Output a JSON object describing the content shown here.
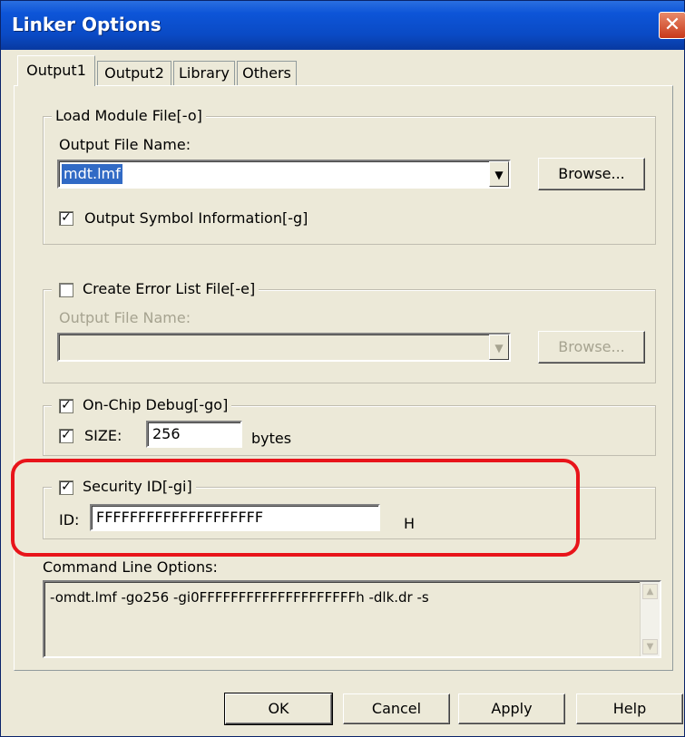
{
  "window": {
    "title": "Linker Options"
  },
  "tabs": [
    {
      "label": "Output1",
      "active": true
    },
    {
      "label": "Output2",
      "active": false
    },
    {
      "label": "Library",
      "active": false
    },
    {
      "label": "Others",
      "active": false
    }
  ],
  "load_module": {
    "group_title": "Load Module File[-o]",
    "output_label": "Output File Name:",
    "output_value": "mdt.lmf",
    "browse": "Browse...",
    "symbol_checked": true,
    "symbol_label": "Output Symbol Information[-g]"
  },
  "error_list": {
    "checked": false,
    "label": "Create Error List File[-e]",
    "output_label": "Output File Name:",
    "output_value": "",
    "browse": "Browse..."
  },
  "onchip": {
    "checked": true,
    "label": "On-Chip Debug[-go]",
    "size_checked": true,
    "size_label": "SIZE:",
    "size_value": "256",
    "unit": "bytes"
  },
  "security": {
    "checked": true,
    "label": "Security ID[-gi]",
    "id_label": "ID:",
    "id_value": "FFFFFFFFFFFFFFFFFFFF",
    "suffix": "H"
  },
  "command_line": {
    "label": "Command Line Options:",
    "value": "-omdt.lmf -go256 -gi0FFFFFFFFFFFFFFFFFFFFh -dlk.dr -s"
  },
  "footer": {
    "ok": "OK",
    "cancel": "Cancel",
    "apply": "Apply",
    "help": "Help"
  },
  "icons": {
    "close": "close-icon",
    "check": "checkmark-icon",
    "dropdown": "chevron-down-icon"
  },
  "colors": {
    "titlebar": "#0a4ac4",
    "selection": "#316ac5",
    "highlight": "#e8141a"
  }
}
